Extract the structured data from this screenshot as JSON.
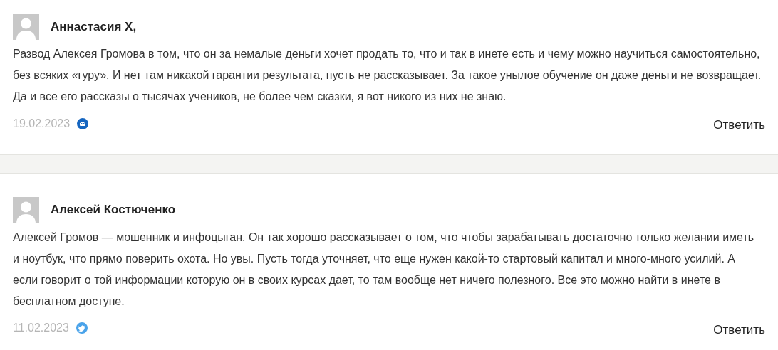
{
  "comments": [
    {
      "author": "Аннастасия Х,",
      "text": "Развод Алексея Громова в том, что он за немалые деньги хочет продать то, что и так в инете есть и чему можно научиться самостоятельно, без всяких «гуру». И нет там никакой гарантии результата, пусть не рассказывает. За такое унылое обучение он даже деньги не возвращает. Да и все его рассказы о тысячах учеников, не более чем сказки, я вот никого из них не знаю.",
      "date": "19.02.2023",
      "source": {
        "kind": "mail",
        "color": "#1565c0"
      },
      "reply": "Ответить"
    },
    {
      "author": "Алексей Костюченко",
      "text": "Алексей Громов — мошенник и инфоцыган. Он так хорошо рассказывает о том, что чтобы зарабатывать достаточно только желании иметь и ноутбук, что прямо поверить охота. Но увы. Пусть тогда уточняет, что еще нужен какой-то стартовый капитал и много-много усилий. А если говорит о той информации которую он в своих курсах дает, то там вообще нет ничего полезного. Все это можно найти в инете в бесплатном доступе.",
      "date": "11.02.2023",
      "source": {
        "kind": "bird",
        "color": "#4aa3ea"
      },
      "reply": "Ответить"
    }
  ]
}
